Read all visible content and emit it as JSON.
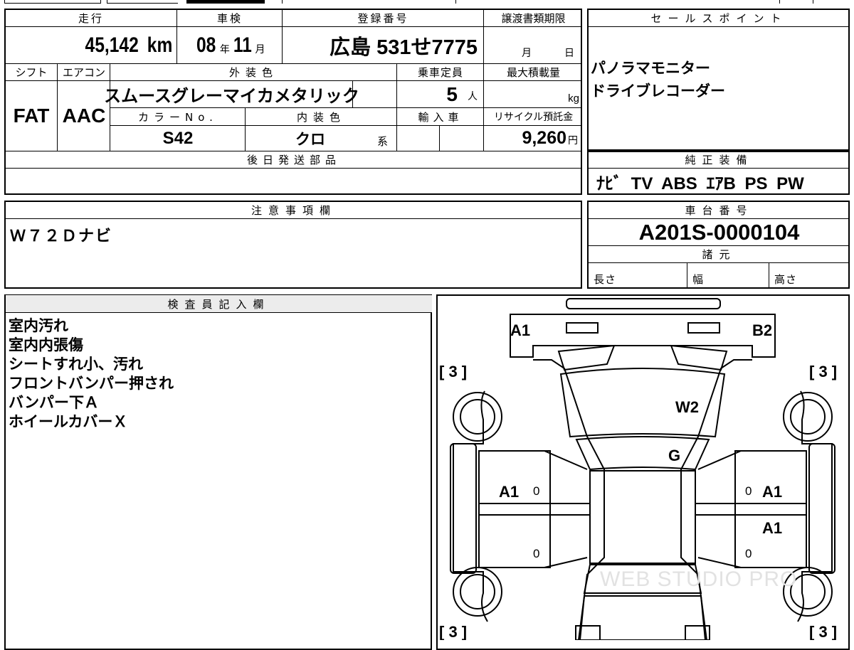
{
  "summary": {
    "mileage_label": "走行",
    "mileage_value": "45,142",
    "mileage_unit": "km",
    "inspection_label": "車検",
    "inspection_year": "08",
    "inspection_year_unit": "年",
    "inspection_month": "11",
    "inspection_month_unit": "月",
    "registration_label": "登録番号",
    "registration_value": "広島 531せ7775",
    "transfer_label": "譲渡書類期限",
    "transfer_month_unit": "月",
    "transfer_day_unit": "日"
  },
  "specs": {
    "shift_label": "シフト",
    "shift_value": "FAT",
    "ac_label": "エアコン",
    "ac_value": "AAC",
    "exterior_color_label": "外装色",
    "exterior_color_value": "スムースグレーマイカメタリック",
    "capacity_label": "乗車定員",
    "capacity_value": "5",
    "capacity_unit": "人",
    "max_load_label": "最大積載量",
    "max_load_unit": "kg",
    "color_no_label": "カラーNo.",
    "color_no_value": "S42",
    "interior_color_label": "内装色",
    "interior_color_value": "クロ",
    "interior_color_unit": "系",
    "import_label": "輸入車",
    "recycle_label": "リサイクル預託金",
    "recycle_value": "9,260",
    "recycle_unit": "円"
  },
  "later_parts": {
    "label": "後日発送部品",
    "value": ""
  },
  "sales_points": {
    "label": "セールスポイント",
    "items": [
      "パノラマモニター",
      "ドライブレコーダー"
    ]
  },
  "equipment": {
    "label": "純正装備",
    "value": "ﾅﾋﾞ TV ABS ｴｱB PS PW"
  },
  "notes": {
    "label": "注意事項欄",
    "value": "Ｗ７２Ｄナビ"
  },
  "chassis": {
    "label": "車台番号",
    "value": "A201S-0000104",
    "specs_label": "諸元",
    "length_label": "長さ",
    "width_label": "幅",
    "height_label": "高さ"
  },
  "inspector": {
    "label": "検査員記入欄",
    "lines": [
      "室内汚れ",
      "室内内張傷",
      "シートすれ小、汚れ",
      "フロントバンパー押され",
      "バンパー下Ａ",
      "ホイールカバーＸ"
    ]
  },
  "diagram": {
    "tire_marks": [
      "[ 3 ]",
      "[ 3 ]",
      "[ 3 ]",
      "[ 3 ]"
    ],
    "damage_codes": {
      "front_left_bumper": "A1",
      "front_right_bumper": "B2",
      "windshield": "W2",
      "hood": "G",
      "left_door": "A1",
      "right_front_door": "A1",
      "right_rear_door": "A1"
    },
    "door_zero": "0",
    "watermark": "WEB STUDIO PRO"
  }
}
